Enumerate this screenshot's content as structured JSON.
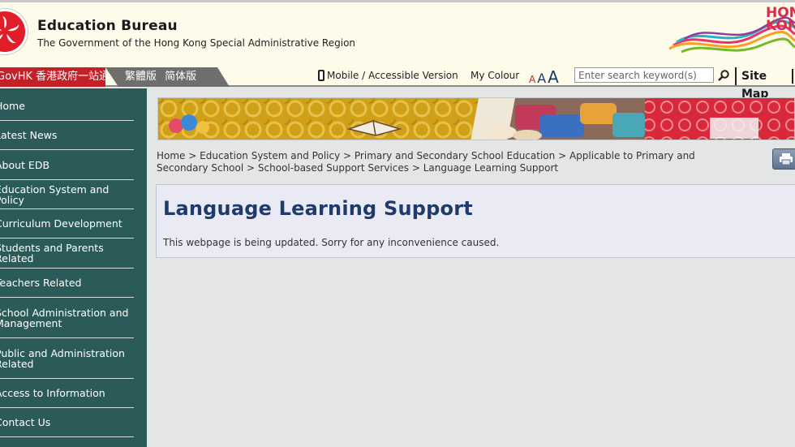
{
  "header": {
    "org_title": "Education Bureau",
    "org_subtitle": "The Government of the Hong Kong Special Administrative Region",
    "brand_text": "HONG KONG"
  },
  "navbar": {
    "gov_portal": "GovHK 香港政府一站通",
    "trad_chinese": "繁體版",
    "simp_chinese": "简体版",
    "mobile_label": "Mobile / Accessible Version",
    "my_colour": "My Colour",
    "font_small": "A",
    "font_medium": "A",
    "font_large": "A",
    "search_placeholder": "Enter search keyword(s)",
    "site_map": "Site Map"
  },
  "sidebar": {
    "items": [
      {
        "label": "Home"
      },
      {
        "label": "Latest News"
      },
      {
        "label": "About EDB"
      },
      {
        "label": "Education System and Policy"
      },
      {
        "label": "Curriculum Development"
      },
      {
        "label": "Students and Parents Related"
      },
      {
        "label": "Teachers Related"
      },
      {
        "label": "School Administration and\nManagement"
      },
      {
        "label": "Public and Administration\nRelated"
      },
      {
        "label": "Access to Information"
      },
      {
        "label": "Contact Us"
      }
    ]
  },
  "breadcrumb": {
    "items": [
      "Home",
      "Education System and Policy",
      "Primary and Secondary School Education",
      "Applicable to Primary and Secondary School",
      "School-based Support Services",
      "Language Learning Support"
    ],
    "separator": ">"
  },
  "main": {
    "title": "Language Learning Support",
    "notice": "This webpage is being updated. Sorry for any inconvenience caused."
  },
  "colors": {
    "sidebar_bg": "#2b5b59",
    "gov_tab": "#c42028",
    "title": "#1f3a6b",
    "content_bg": "#e9eaf4"
  }
}
